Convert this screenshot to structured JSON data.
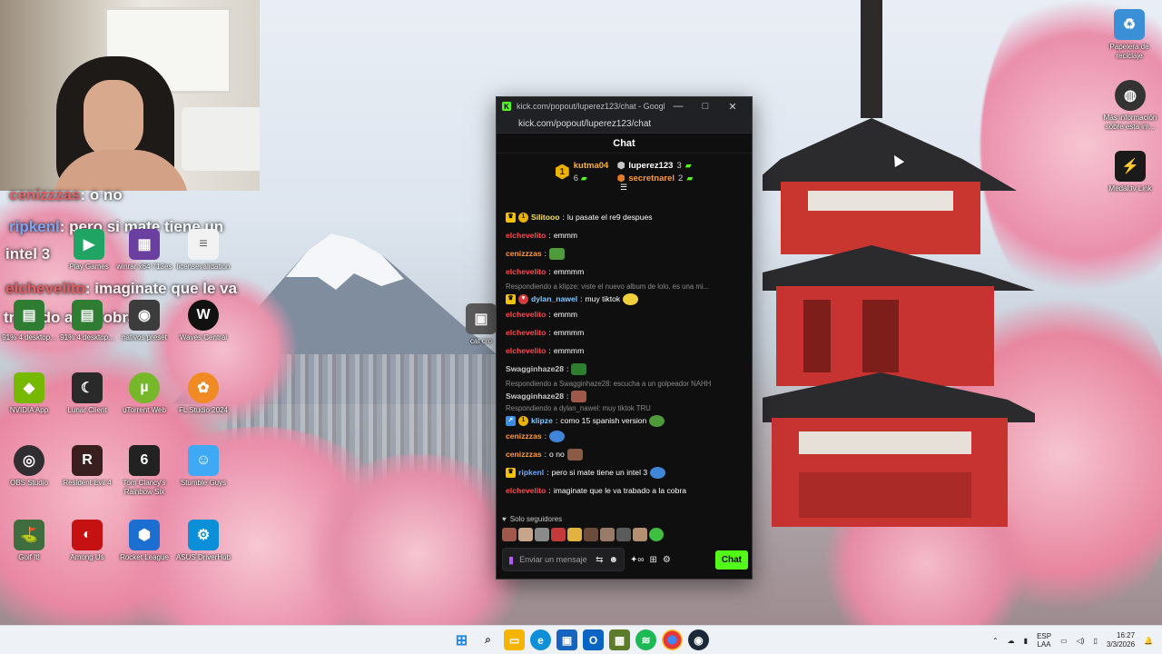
{
  "browser": {
    "window_title": "kick.com/popout/luperez123/chat - Google Chr...",
    "url": "kick.com/popout/luperez123/chat"
  },
  "chat": {
    "header": "Chat",
    "leaderboard": {
      "top": {
        "name": "kutma04",
        "rank": "1",
        "count": "6"
      },
      "second": {
        "name": "luperez123",
        "count": "3"
      },
      "third": {
        "name": "secretnarel",
        "count": "2"
      }
    },
    "messages": [
      {
        "user": "Silitooo",
        "text": "lu pasate el re9 despues",
        "color": "#f6e35a"
      },
      {
        "user": "elchevelito",
        "text": "emmm",
        "color": "#ff4a4a"
      },
      {
        "user": "cenizzzas",
        "text": "",
        "color": "#ff9b3d"
      },
      {
        "user": "elchevelito",
        "text": "emmmm",
        "color": "#ff4a4a"
      },
      {
        "reply_note": "Respondiendo a klipze: viste el nuevo album de lolo. es una mi...",
        "user": "dylan_nawel",
        "text": "muy tiktok",
        "color": "#7ec8ff"
      },
      {
        "user": "elchevelito",
        "text": "emmm",
        "color": "#ff4a4a"
      },
      {
        "user": "elchevelito",
        "text": "emmmm",
        "color": "#ff4a4a"
      },
      {
        "user": "elchevelito",
        "text": "emmmm",
        "color": "#ff4a4a"
      },
      {
        "user": "Swagginhaze28",
        "text": "",
        "color": "#c8c8c8"
      },
      {
        "reply_note": "Respondiendo a Swagginhaze28: escucha a un golpeador NAHH",
        "user": "Swagginhaze28",
        "text": "",
        "color": "#c8c8c8"
      },
      {
        "reply_note": "Respondiendo a dylan_nawel: muy tiktok TRU",
        "user": "klipze",
        "text": "como 15 spanish version",
        "color": "#7ec8ff"
      },
      {
        "user": "cenizzzas",
        "text": "",
        "color": "#ff9b3d"
      },
      {
        "user": "cenizzzas",
        "text": "o no",
        "color": "#ff9b3d"
      },
      {
        "user": "ripkenl",
        "text": "pero si mate tiene un intel 3",
        "color": "#6aa6ff"
      },
      {
        "user": "elchevelito",
        "text": "imaginate que le va trabado a la cobra",
        "color": "#ff4a4a"
      }
    ],
    "followers_only": "Solo seguidores",
    "input_placeholder": "Enviar un mensaje",
    "send_label": "Chat"
  },
  "overlay": [
    {
      "user": "cenizzzas",
      "text": ": o no"
    },
    {
      "user": "ripkenl",
      "text": ": pero si mate tiene un"
    },
    {
      "user": "",
      "text": "intel 3"
    },
    {
      "user": "elchevelito",
      "text": ": imaginate que le va"
    },
    {
      "user": "",
      "text": "trabado a la cobra"
    }
  ],
  "desktop_icons": [
    {
      "label": "Play Games",
      "color": "#1fa463"
    },
    {
      "label": "winrar x64 713es",
      "color": "#6b3fa0"
    },
    {
      "label": "licensevalidation",
      "color": "#e8e8e8"
    },
    {
      "label": "91% 4 desktop...",
      "color": "#2e7d32"
    },
    {
      "label": "91% 4 desktop...",
      "color": "#2e7d32"
    },
    {
      "label": "nativos preset",
      "color": "#3c3c3c"
    },
    {
      "label": "Waves Central",
      "color": "#111111"
    },
    {
      "label": "cat cro",
      "color": "#5a5a5a"
    },
    {
      "label": "NVIDIA App",
      "color": "#76b900"
    },
    {
      "label": "Lunar Client",
      "color": "#2a2a2a"
    },
    {
      "label": "uTorrent Web",
      "color": "#77b82a"
    },
    {
      "label": "FL Studio 2024",
      "color": "#f08a24"
    },
    {
      "label": "OBS Studio",
      "color": "#302e31"
    },
    {
      "label": "Resident Evil 4",
      "color": "#3a1f1f"
    },
    {
      "label": "Tom Clancy's Rainbow Six",
      "color": "#222222"
    },
    {
      "label": "Stumble Guys",
      "color": "#3fa9f5"
    },
    {
      "label": "Golf It!",
      "color": "#3f6d3f"
    },
    {
      "label": "Among Us",
      "color": "#c51111"
    },
    {
      "label": "Rocket League",
      "color": "#1c6fd1"
    },
    {
      "label": "ASUS DriverHub",
      "color": "#0a8fd8"
    },
    {
      "label": "Papelera de reciclaje",
      "color": "#3b8fd6"
    },
    {
      "label": "Más información sobre esta im...",
      "color": "#333333"
    },
    {
      "label": "Medal.tv Link",
      "color": "#1a1a1a"
    }
  ],
  "taskbar": {
    "language": "ESP",
    "language_sub": "LAA",
    "time": "16:27",
    "date": "3/3/2026",
    "apps": [
      {
        "icon": "windows-icon",
        "color": "#1e88e5"
      },
      {
        "icon": "search-icon",
        "color": "#333333"
      },
      {
        "icon": "file-explorer-icon",
        "color": "#f4b400"
      },
      {
        "icon": "edge-icon",
        "color": "#0f8fd8"
      },
      {
        "icon": "store-icon",
        "color": "#1565c0"
      },
      {
        "icon": "outlook-icon",
        "color": "#0a64c4"
      },
      {
        "icon": "minecraft-icon",
        "color": "#5c7c2a"
      },
      {
        "icon": "spotify-icon",
        "color": "#1db954"
      },
      {
        "icon": "chrome-icon",
        "color": "#e53935"
      },
      {
        "icon": "steam-icon",
        "color": "#1b2838"
      }
    ]
  },
  "colors": {
    "kick_green": "#53fc18",
    "chat_bg": "#0f0f10"
  }
}
